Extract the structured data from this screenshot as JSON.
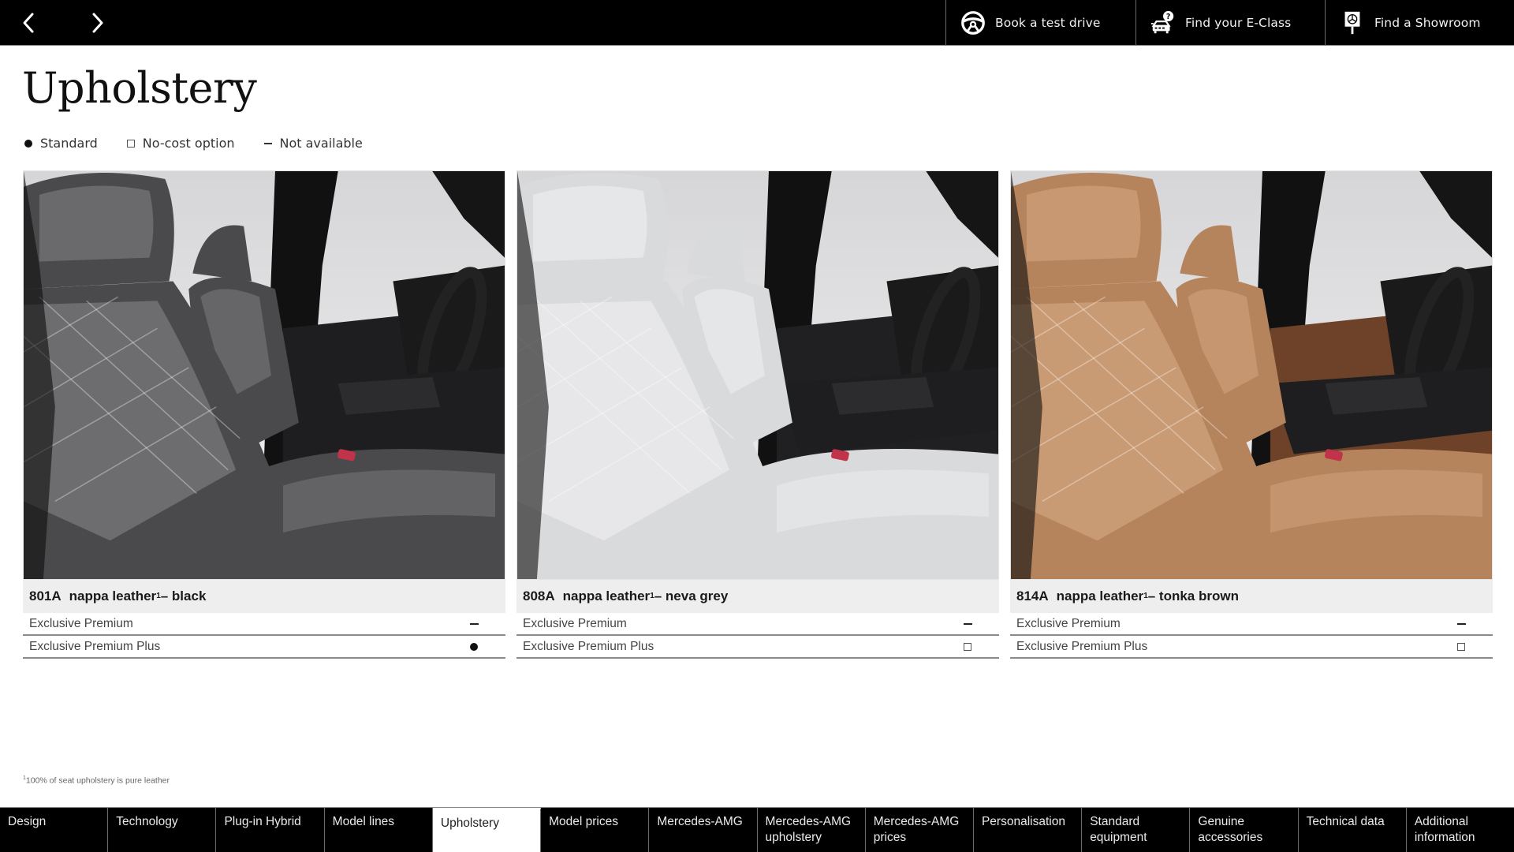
{
  "header": {
    "prev_label": "Previous page",
    "next_label": "Next page",
    "actions": [
      {
        "label": "Book a test drive",
        "icon": "steering-wheel-icon"
      },
      {
        "label": "Find your E-Class",
        "icon": "car-question-icon"
      },
      {
        "label": "Find a Showroom",
        "icon": "showroom-sign-icon"
      }
    ]
  },
  "page": {
    "title": "Upholstery"
  },
  "legend": [
    {
      "symbol": "dot",
      "label": "Standard"
    },
    {
      "symbol": "box",
      "label": "No-cost option"
    },
    {
      "symbol": "dash",
      "label": "Not available"
    }
  ],
  "cards": [
    {
      "code": "801A",
      "name": "nappa leather",
      "footnote_ref": "1",
      "colour_suffix": " – black",
      "image_alt": "Black nappa leather seats",
      "palette": {
        "seat": "#4a4a4c",
        "seat_light": "#8a8a8c",
        "trim": "#1e1e20"
      },
      "rows": [
        {
          "line": "Exclusive Premium",
          "availability": "dash"
        },
        {
          "line": "Exclusive Premium Plus",
          "availability": "dot"
        }
      ]
    },
    {
      "code": "808A",
      "name": "nappa leather",
      "footnote_ref": "1",
      "colour_suffix": " – neva grey",
      "image_alt": "Neva grey nappa leather seats",
      "palette": {
        "seat": "#d9dadc",
        "seat_light": "#f3f3f4",
        "trim": "#202022"
      },
      "rows": [
        {
          "line": "Exclusive Premium",
          "availability": "dash"
        },
        {
          "line": "Exclusive Premium Plus",
          "availability": "box"
        }
      ]
    },
    {
      "code": "814A",
      "name": "nappa leather",
      "footnote_ref": "1",
      "colour_suffix": " – tonka brown",
      "image_alt": "Tonka brown nappa leather seats",
      "palette": {
        "seat": "#b5835c",
        "seat_light": "#d9ae88",
        "trim": "#6e4228"
      },
      "rows": [
        {
          "line": "Exclusive Premium",
          "availability": "dash"
        },
        {
          "line": "Exclusive Premium Plus",
          "availability": "box"
        }
      ]
    }
  ],
  "footnote": {
    "ref": "1",
    "text": "100% of seat upholstery is pure leather"
  },
  "tabs": [
    {
      "label": "Design",
      "active": false
    },
    {
      "label": "Technology",
      "active": false
    },
    {
      "label": "Plug-in Hybrid",
      "active": false
    },
    {
      "label": "Model lines",
      "active": false
    },
    {
      "label": "Upholstery",
      "active": true
    },
    {
      "label": "Model prices",
      "active": false
    },
    {
      "label": "Mercedes-AMG",
      "active": false
    },
    {
      "label": "Mercedes-AMG upholstery",
      "active": false
    },
    {
      "label": "Mercedes-AMG prices",
      "active": false
    },
    {
      "label": "Personalisation",
      "active": false
    },
    {
      "label": "Standard equipment",
      "active": false
    },
    {
      "label": "Genuine accessories",
      "active": false
    },
    {
      "label": "Technical data",
      "active": false
    },
    {
      "label": "Additional information",
      "active": false
    }
  ]
}
